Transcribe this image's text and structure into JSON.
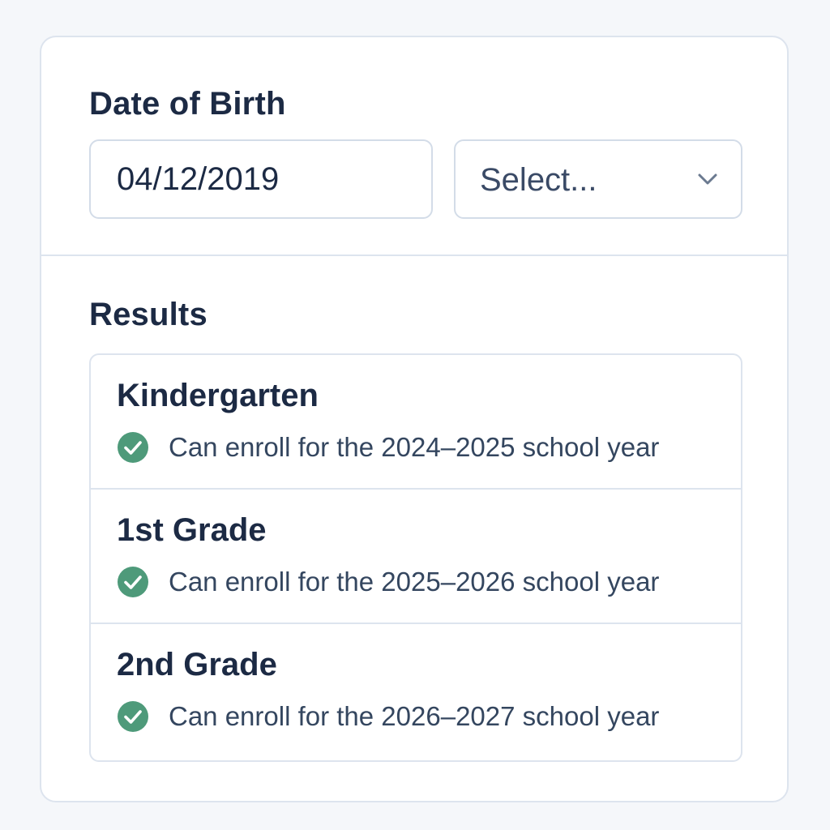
{
  "form": {
    "dob_label": "Date of Birth",
    "dob_value": "04/12/2019",
    "select_placeholder": "Select..."
  },
  "results": {
    "heading": "Results",
    "items": [
      {
        "grade": "Kindergarten",
        "status": "Can enroll for the 2024–2025 school year",
        "icon": "check-circle-icon"
      },
      {
        "grade": "1st Grade",
        "status": "Can enroll for the 2025–2026 school year",
        "icon": "check-circle-icon"
      },
      {
        "grade": "2nd Grade",
        "status": "Can enroll for the 2026–2027 school year",
        "icon": "check-circle-icon"
      }
    ]
  },
  "colors": {
    "background": "#f5f7fa",
    "card": "#ffffff",
    "border": "#dde4ee",
    "text_primary": "#1c2a44",
    "text_secondary": "#34465f",
    "success": "#4e9a7a"
  }
}
